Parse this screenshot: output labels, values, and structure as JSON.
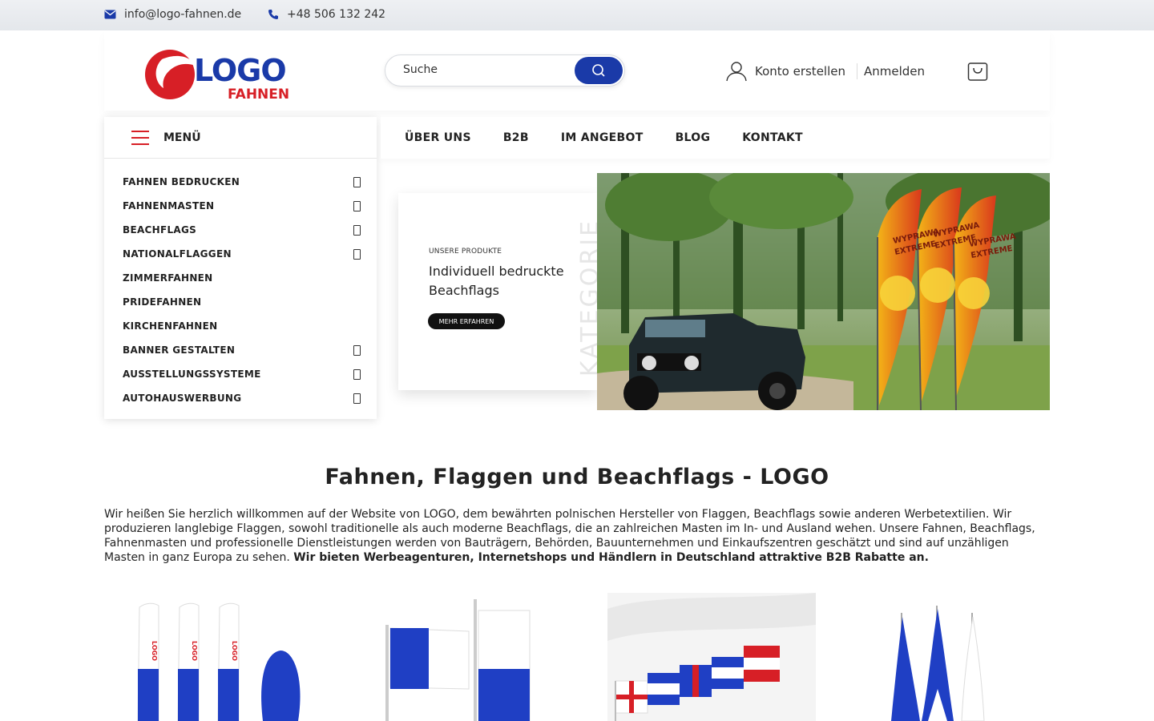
{
  "topbar": {
    "email": "info@logo-fahnen.de",
    "phone": "+48 506 132 242"
  },
  "header": {
    "logo_word": "LOGO",
    "logo_sub": "FAHNEN",
    "search_placeholder": "Suche",
    "account_create": "Konto erstellen",
    "login": "Anmelden"
  },
  "menu": {
    "label": "MENÜ",
    "items": [
      {
        "label": "FAHNEN BEDRUCKEN",
        "has_sub": true
      },
      {
        "label": "FAHNENMASTEN",
        "has_sub": true
      },
      {
        "label": "BEACHFLAGS",
        "has_sub": true
      },
      {
        "label": "NATIONALFLAGGEN",
        "has_sub": true
      },
      {
        "label": "ZIMMERFAHNEN",
        "has_sub": false
      },
      {
        "label": "PRIDEFAHNEN",
        "has_sub": false
      },
      {
        "label": "KIRCHENFAHNEN",
        "has_sub": false
      },
      {
        "label": "BANNER GESTALTEN",
        "has_sub": true
      },
      {
        "label": "AUSSTELLUNGSSYSTEME",
        "has_sub": true
      },
      {
        "label": "AUTOHAUSWERBUNG",
        "has_sub": true
      }
    ]
  },
  "nav": [
    "ÜBER UNS",
    "B2B",
    "IM ANGEBOT",
    "BLOG",
    "KONTAKT"
  ],
  "hero": {
    "eyebrow": "UNSERE PRODUKTE",
    "title": "Individuell bedruckte Beachflags",
    "button": "MEHR ERFAHREN",
    "vertical": "KATEGORIE",
    "flag_text_1": "WYPRAWA",
    "flag_text_2": "EXTREME"
  },
  "main": {
    "title": "Fahnen, Flaggen und Beachflags - LOGO",
    "intro": "Wir heißen Sie herzlich willkommen auf der Website von LOGO, dem bewährten polnischen Hersteller von Flaggen, Beachflags sowie anderen Werbetextilien. Wir produzieren langlebige Flaggen, sowohl traditionelle als auch moderne Beachflags, die an zahlreichen Masten im In- und Ausland wehen. Unsere Fahnen, Beachflags, Fahnenmasten und professionelle Dienstleistungen werden von Bauträgern, Behörden, Bauunternehmen und Einkaufszentren geschätzt und sind auf unzähligen Masten in ganz Europa zu sehen.",
    "intro_bold": "Wir bieten Werbeagenturen, Internetshops und Händlern in Deutschland attraktive B2B Rabatte an."
  },
  "colors": {
    "brand_blue": "#1a3aa8",
    "brand_red": "#d71f26"
  }
}
